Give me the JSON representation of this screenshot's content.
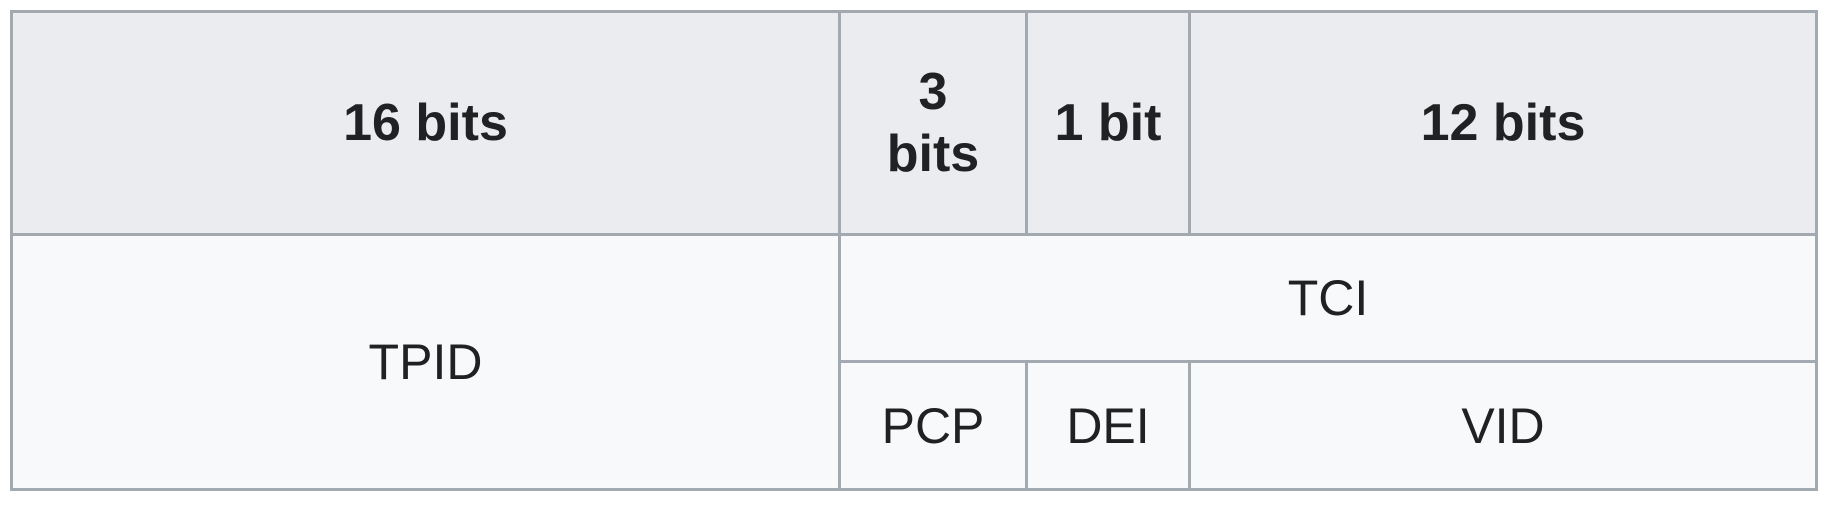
{
  "header": {
    "tpid_width": "16 bits",
    "pcp_width": "3 bits",
    "dei_width": "1 bit",
    "vid_width": "12 bits"
  },
  "fields": {
    "tpid": "TPID",
    "tci": "TCI",
    "pcp": "PCP",
    "dei": "DEI",
    "vid": "VID"
  }
}
